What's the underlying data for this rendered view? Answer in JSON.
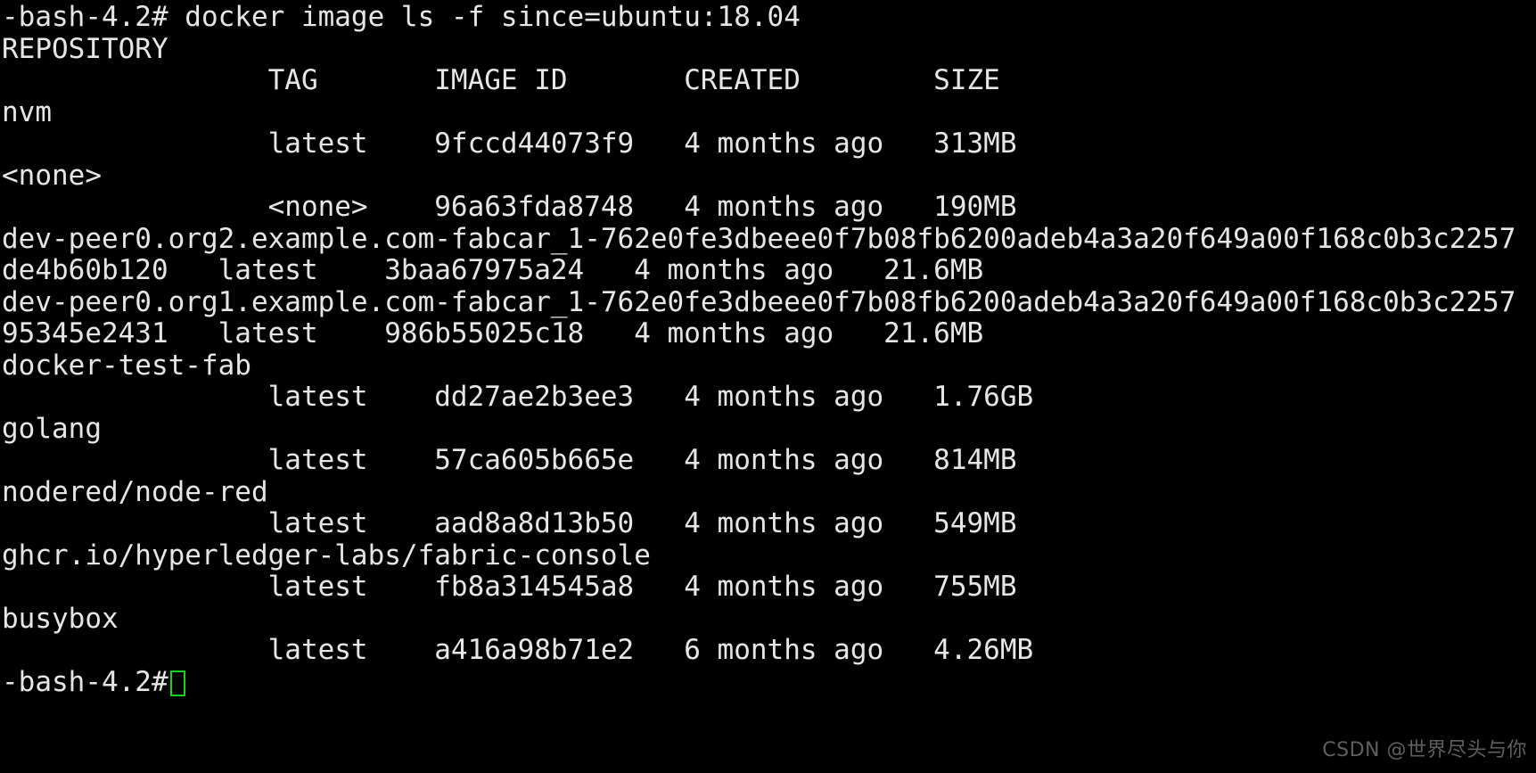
{
  "terminal": {
    "prompt": "-bash-4.2#",
    "command": "docker image ls -f since=ubuntu:18.04",
    "command_line": "-bash-4.2# docker image ls -f since=ubuntu:18.04",
    "header_repository": "REPOSITORY",
    "header_columns": "                TAG       IMAGE ID       CREATED        SIZE",
    "lines": [
      "-bash-4.2# docker image ls -f since=ubuntu:18.04",
      "REPOSITORY",
      "                TAG       IMAGE ID       CREATED        SIZE",
      "nvm",
      "                latest    9fccd44073f9   4 months ago   313MB",
      "<none>",
      "                <none>    96a63fda8748   4 months ago   190MB",
      "dev-peer0.org2.example.com-fabcar_1-762e0fe3dbeee0f7b08fb6200adeb4a3a20f649a00f168c0b3c2257",
      "de4b60b120   latest    3baa67975a24   4 months ago   21.6MB",
      "dev-peer0.org1.example.com-fabcar_1-762e0fe3dbeee0f7b08fb6200adeb4a3a20f649a00f168c0b3c2257",
      "95345e2431   latest    986b55025c18   4 months ago   21.6MB",
      "docker-test-fab",
      "                latest    dd27ae2b3ee3   4 months ago   1.76GB",
      "golang",
      "                latest    57ca605b665e   4 months ago   814MB",
      "nodered/node-red",
      "                latest    aad8a8d13b50   4 months ago   549MB",
      "ghcr.io/hyperledger-labs/fabric-console",
      "                latest    fb8a314545a8   4 months ago   755MB",
      "busybox",
      "                latest    a416a98b71e2   6 months ago   4.26MB"
    ],
    "final_prompt": "-bash-4.2#",
    "cursor": "block-cursor",
    "table": {
      "columns": [
        "REPOSITORY",
        "TAG",
        "IMAGE ID",
        "CREATED",
        "SIZE"
      ],
      "rows": [
        {
          "repository": "nvm",
          "tag": "latest",
          "image_id": "9fccd44073f9",
          "created": "4 months ago",
          "size": "313MB"
        },
        {
          "repository": "<none>",
          "tag": "<none>",
          "image_id": "96a63fda8748",
          "created": "4 months ago",
          "size": "190MB"
        },
        {
          "repository": "dev-peer0.org2.example.com-fabcar_1-762e0fe3dbeee0f7b08fb6200adeb4a3a20f649a00f168c0b3c2257de4b60b120",
          "tag": "latest",
          "image_id": "3baa67975a24",
          "created": "4 months ago",
          "size": "21.6MB"
        },
        {
          "repository": "dev-peer0.org1.example.com-fabcar_1-762e0fe3dbeee0f7b08fb6200adeb4a3a20f649a00f168c0b3c225795345e2431",
          "tag": "latest",
          "image_id": "986b55025c18",
          "created": "4 months ago",
          "size": "21.6MB"
        },
        {
          "repository": "docker-test-fab",
          "tag": "latest",
          "image_id": "dd27ae2b3ee3",
          "created": "4 months ago",
          "size": "1.76GB"
        },
        {
          "repository": "golang",
          "tag": "latest",
          "image_id": "57ca605b665e",
          "created": "4 months ago",
          "size": "814MB"
        },
        {
          "repository": "nodered/node-red",
          "tag": "latest",
          "image_id": "aad8a8d13b50",
          "created": "4 months ago",
          "size": "549MB"
        },
        {
          "repository": "ghcr.io/hyperledger-labs/fabric-console",
          "tag": "latest",
          "image_id": "fb8a314545a8",
          "created": "4 months ago",
          "size": "755MB"
        },
        {
          "repository": "busybox",
          "tag": "latest",
          "image_id": "a416a98b71e2",
          "created": "6 months ago",
          "size": "4.26MB"
        }
      ]
    },
    "colors": {
      "background": "#000000",
      "foreground": "#e6e6e6",
      "cursor": "#18d318",
      "watermark": "#7a7a7a"
    }
  },
  "watermark": {
    "text": "CSDN @世界尽头与你"
  }
}
